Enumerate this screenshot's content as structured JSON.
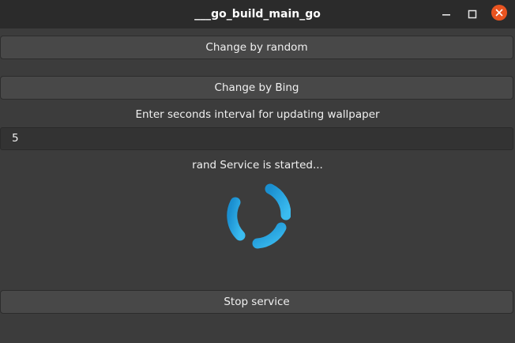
{
  "window": {
    "title": "___go_build_main_go"
  },
  "controls": {
    "random_button": "Change by random",
    "bing_button": "Change by  Bing",
    "interval_label": "Enter seconds interval for updating wallpaper",
    "interval_value": "5",
    "status_text": "rand Service is started...",
    "stop_button": "Stop service"
  },
  "icons": {
    "minimize": "minimize-icon",
    "maximize": "maximize-icon",
    "close": "close-icon",
    "spinner": "loading-spinner"
  },
  "colors": {
    "accent": "#29a7e0",
    "close": "#e95420",
    "background": "#3c3c3c",
    "titlebar": "#2b2b2b"
  }
}
